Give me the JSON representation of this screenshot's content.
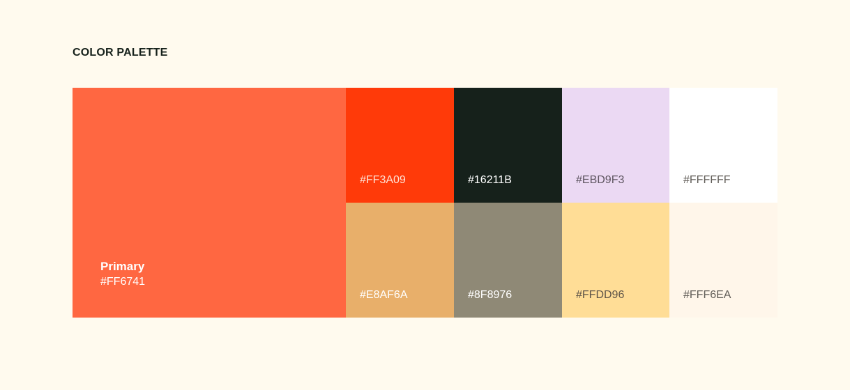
{
  "header": {
    "title": "COLOR PALETTE"
  },
  "primary": {
    "name": "Primary",
    "hex": "#FF6741",
    "color": "#FF6741",
    "text_color": "#FFFFFF"
  },
  "swatches": [
    {
      "hex": "#FF3A09",
      "color": "#FF3A09",
      "text_color": "#FFE2D6"
    },
    {
      "hex": "#16211B",
      "color": "#16211B",
      "text_color": "#FFFFFF"
    },
    {
      "hex": "#EBD9F3",
      "color": "#EBD9F3",
      "text_color": "#5E5560"
    },
    {
      "hex": "#FFFFFF",
      "color": "#FFFFFF",
      "text_color": "#5E5A55"
    },
    {
      "hex": "#E8AF6A",
      "color": "#E8AF6A",
      "text_color": "#FFFFFF"
    },
    {
      "hex": "#8F8976",
      "color": "#8F8976",
      "text_color": "#FFFFFF"
    },
    {
      "hex": "#FFDD96",
      "color": "#FFDD96",
      "text_color": "#5E5448"
    },
    {
      "hex": "#FFF6EA",
      "color": "#FFF6EA",
      "text_color": "#5E5A55"
    }
  ]
}
